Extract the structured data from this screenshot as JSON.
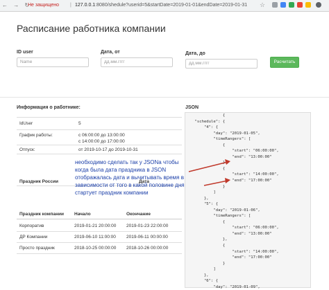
{
  "browser": {
    "nav_icons": "← → ↻",
    "security_text": "Не защищено",
    "url_host": "127.0.0.1",
    "url_rest": ":8080/shedule?userid=5&startDate=2019-01-01&endDate=2019-01-31",
    "star_icon": "☆"
  },
  "page": {
    "title": "Расписание работника компании"
  },
  "form": {
    "id_label": "ID user",
    "id_placeholder": "Name",
    "from_label": "Дата, от",
    "from_placeholder": "дд.мм.гггг",
    "to_label": "Дата, до",
    "to_placeholder": "дд.мм.гггг",
    "submit_label": "Расчитать"
  },
  "employee": {
    "heading": "Информация о работнике:",
    "rows": [
      {
        "key": "IdUser",
        "value": "5"
      },
      {
        "key": "График работы:",
        "value": "с 06:00:00 до 13:00:00"
      },
      {
        "key": "",
        "value": "с 14:00:00 до 17:00:00"
      },
      {
        "key": "Отпуск:",
        "value": "от 2019-10-17 до 2019-10-31"
      }
    ]
  },
  "russian_holidays": {
    "col_name": "Праздник России",
    "col_date": "Дата"
  },
  "company_holidays": {
    "col_name": "Праздник компании",
    "col_start": "Начало",
    "col_end": "Окончание",
    "rows": [
      {
        "name": "Корпоратив",
        "start": "2019-01-21 20:00:00",
        "end": "2019-01-23 22:00:00"
      },
      {
        "name": "ДР Компании",
        "start": "2019-06-10 11:00:00",
        "end": "2019-06-11 00:00:00"
      },
      {
        "name": "Просто праздник",
        "start": "2018-10-25 00:00:00",
        "end": "2018-10-26 00:00:00"
      }
    ]
  },
  "json_panel": {
    "heading": "JSON",
    "content": "                {\n    \"schedule\": {\n        \"4\": {\n            \"day\": \"2019-01-05\",\n            \"timeRangers\": [\n                {\n                    \"start\": \"06:00:00\",\n                    \"end\": \"13:00:00\"\n                },\n                {\n                    \"start\": \"14:00:00\",\n                    \"end\": \"17:00:00\"\n                }\n            ]\n        },\n        \"5\": {\n            \"day\": \"2019-01-06\",\n            \"timeRangers\": [\n                {\n                    \"start\": \"06:00:00\",\n                    \"end\": \"13:00:00\"\n                },\n                {\n                    \"start\": \"14:00:00\",\n                    \"end\": \"17:00:00\"\n                }\n            ]\n        },\n        \"6\": {\n            \"day\": \"2019-01-09\","
  },
  "annotation": {
    "text": "необходимо сделать так у JSONа чтобы когда была дата праздника в JSON отображалась дата и вычитывать время в зависимости от того в какой половине дня стартует праздник компании",
    "color": "#1a3ea8"
  },
  "colors": {
    "button": "#5cb85c",
    "warning": "#c5221f",
    "json_bg": "#f5f5f5"
  }
}
